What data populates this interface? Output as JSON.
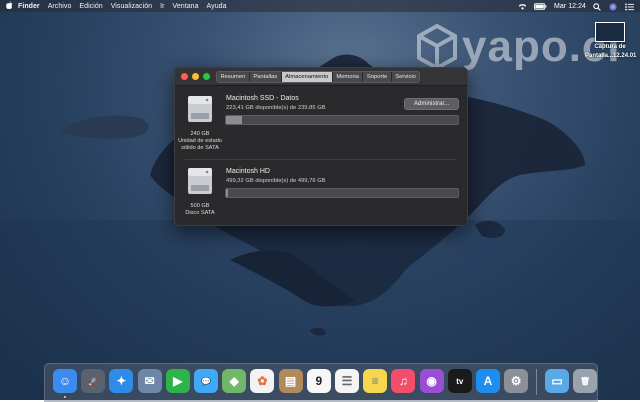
{
  "menubar": {
    "apple": "",
    "items": [
      "Finder",
      "Archivo",
      "Edición",
      "Visualización",
      "Ir",
      "Ventana",
      "Ayuda"
    ],
    "clock": "Mar 12:24",
    "status_icons": [
      "wifi-icon",
      "battery-icon",
      "search-icon",
      "siri-icon",
      "notification-center-icon"
    ]
  },
  "watermark": {
    "text": "yapo.cl"
  },
  "desktop_file": {
    "label_line1": "Captura de",
    "label_line2": "Pantalla...12.24.01"
  },
  "window": {
    "tabs": [
      "Resumen",
      "Pantallas",
      "Almacenamiento",
      "Memoria",
      "Soporte",
      "Servicio"
    ],
    "active_tab": "Almacenamiento",
    "drives": [
      {
        "name": "Macintosh SSD - Datos",
        "available": "223,41 GB disponible(s) de 239,85 GB",
        "capacity": "240 GB",
        "type_line1": "Unidad de estado",
        "type_line2": "sólido de SATA",
        "used_fraction": 0.069
      },
      {
        "name": "Macintosh HD",
        "available": "499,32 GB disponible(s) de 499,76 GB",
        "capacity": "500 GB",
        "type_line1": "Disco SATA",
        "type_line2": "",
        "used_fraction": 0.01
      }
    ],
    "admin_button": "Administrar..."
  },
  "dock": {
    "apps": [
      {
        "name": "finder-icon",
        "color": "#3c8cf0",
        "glyph": "☺"
      },
      {
        "name": "launchpad-icon",
        "color": "#5a6270",
        "glyph": "🚀"
      },
      {
        "name": "safari-icon",
        "color": "#2f8be8",
        "glyph": "✦"
      },
      {
        "name": "mail-icon",
        "color": "#6d87a8",
        "glyph": "✉"
      },
      {
        "name": "facetime-icon",
        "color": "#2db34a",
        "glyph": "▶"
      },
      {
        "name": "messages-icon",
        "color": "#3fa9f5",
        "glyph": "💬"
      },
      {
        "name": "maps-icon",
        "color": "#6fb86a",
        "glyph": "◆"
      },
      {
        "name": "photos-icon",
        "color": "#f3f3f3",
        "glyph": "✿"
      },
      {
        "name": "contacts-icon",
        "color": "#b08a5a",
        "glyph": "▤"
      },
      {
        "name": "calendar-icon",
        "color": "#f7f7f7",
        "glyph": "9"
      },
      {
        "name": "reminders-icon",
        "color": "#f4f4f4",
        "glyph": "☰"
      },
      {
        "name": "notes-icon",
        "color": "#f5d64c",
        "glyph": "≡"
      },
      {
        "name": "music-icon",
        "color": "#f24d6a",
        "glyph": "♫"
      },
      {
        "name": "podcasts-icon",
        "color": "#9b4dd6",
        "glyph": "◉"
      },
      {
        "name": "tv-icon",
        "color": "#1a1a1a",
        "glyph": "tv"
      },
      {
        "name": "app-store-icon",
        "color": "#1e8df0",
        "glyph": "A"
      },
      {
        "name": "system-preferences-icon",
        "color": "#8a8f98",
        "glyph": "⚙"
      },
      {
        "name": "downloads-folder-icon",
        "color": "#5aa9e6",
        "glyph": "▭"
      },
      {
        "name": "trash-icon",
        "color": "#9aa2ad",
        "glyph": "🗑"
      }
    ]
  }
}
